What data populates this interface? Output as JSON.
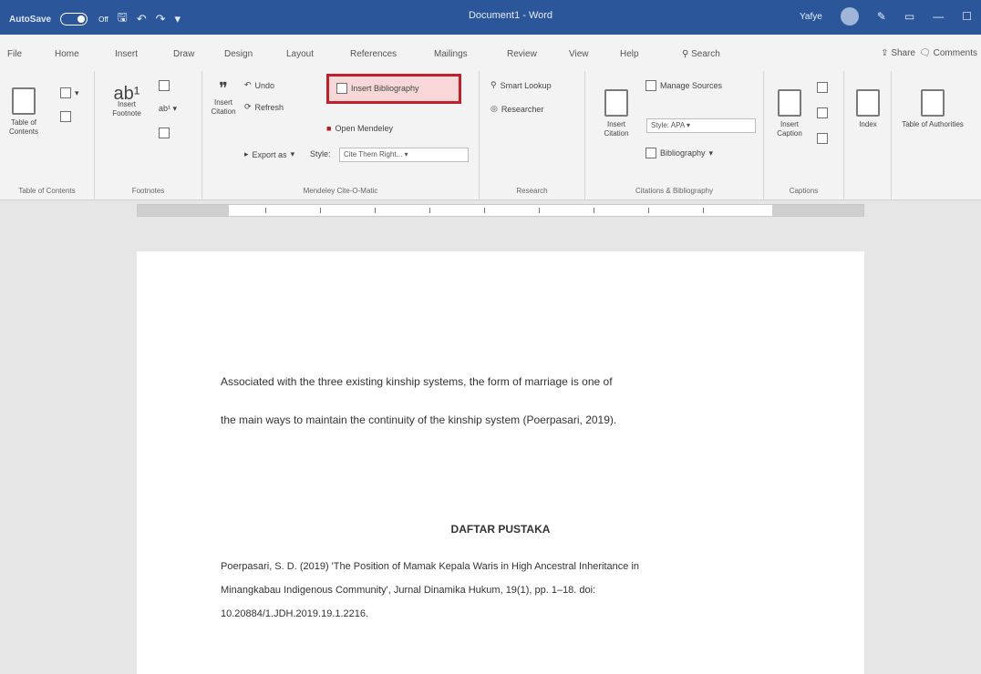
{
  "titlebar": {
    "autosave": "AutoSave",
    "autosave_state": "Off",
    "document_title": "Document1 - Word",
    "user": "Yafye"
  },
  "tabs": [
    "File",
    "Home",
    "Insert",
    "Draw",
    "Design",
    "Layout",
    "References",
    "Mailings",
    "Review",
    "View",
    "Help"
  ],
  "search_label": "Search",
  "share_label": "Share",
  "comments_label": "Comments",
  "ribbon": {
    "toc": {
      "button": "Table of Contents",
      "group": "Table of Contents"
    },
    "footnotes": {
      "insert_footnote": "Insert Footnote",
      "group": "Footnotes"
    },
    "mendeley": {
      "insert_citation": "Insert Citation",
      "undo": "Undo",
      "refresh": "Refresh",
      "export_as": "Export as",
      "insert_bibliography": "Insert Bibliography",
      "open_mendeley": "Open Mendeley",
      "style_label": "Style:",
      "style_value": "Cite Them Right...",
      "group": "Mendeley Cite-O-Matic"
    },
    "research": {
      "smart_lookup": "Smart Lookup",
      "researcher": "Researcher",
      "group": "Research"
    },
    "citations": {
      "insert_citation": "Insert Citation",
      "manage_sources": "Manage Sources",
      "style_label": "Style:",
      "style_value": "APA",
      "bibliography": "Bibliography",
      "group": "Citations & Bibliography"
    },
    "captions": {
      "insert_caption": "Insert Caption",
      "group": "Captions"
    },
    "index": {
      "button": "Index"
    },
    "toa": {
      "button": "Table of Authorities"
    }
  },
  "document": {
    "para_line1": "Associated with the three existing kinship systems, the form of marriage is one of",
    "para_line2": "the main ways to maintain the continuity of the kinship system (Poerpasari, 2019).",
    "bib_heading": "DAFTAR PUSTAKA",
    "ref_line1": "Poerpasari, S. D. (2019) 'The Position of Mamak Kepala Waris in High Ancestral Inheritance in",
    "ref_line2": "Minangkabau Indigenous Community', Jurnal Dinamika Hukum, 19(1), pp. 1–18. doi:",
    "ref_line3": "10.20884/1.JDH.2019.19.1.2216."
  }
}
